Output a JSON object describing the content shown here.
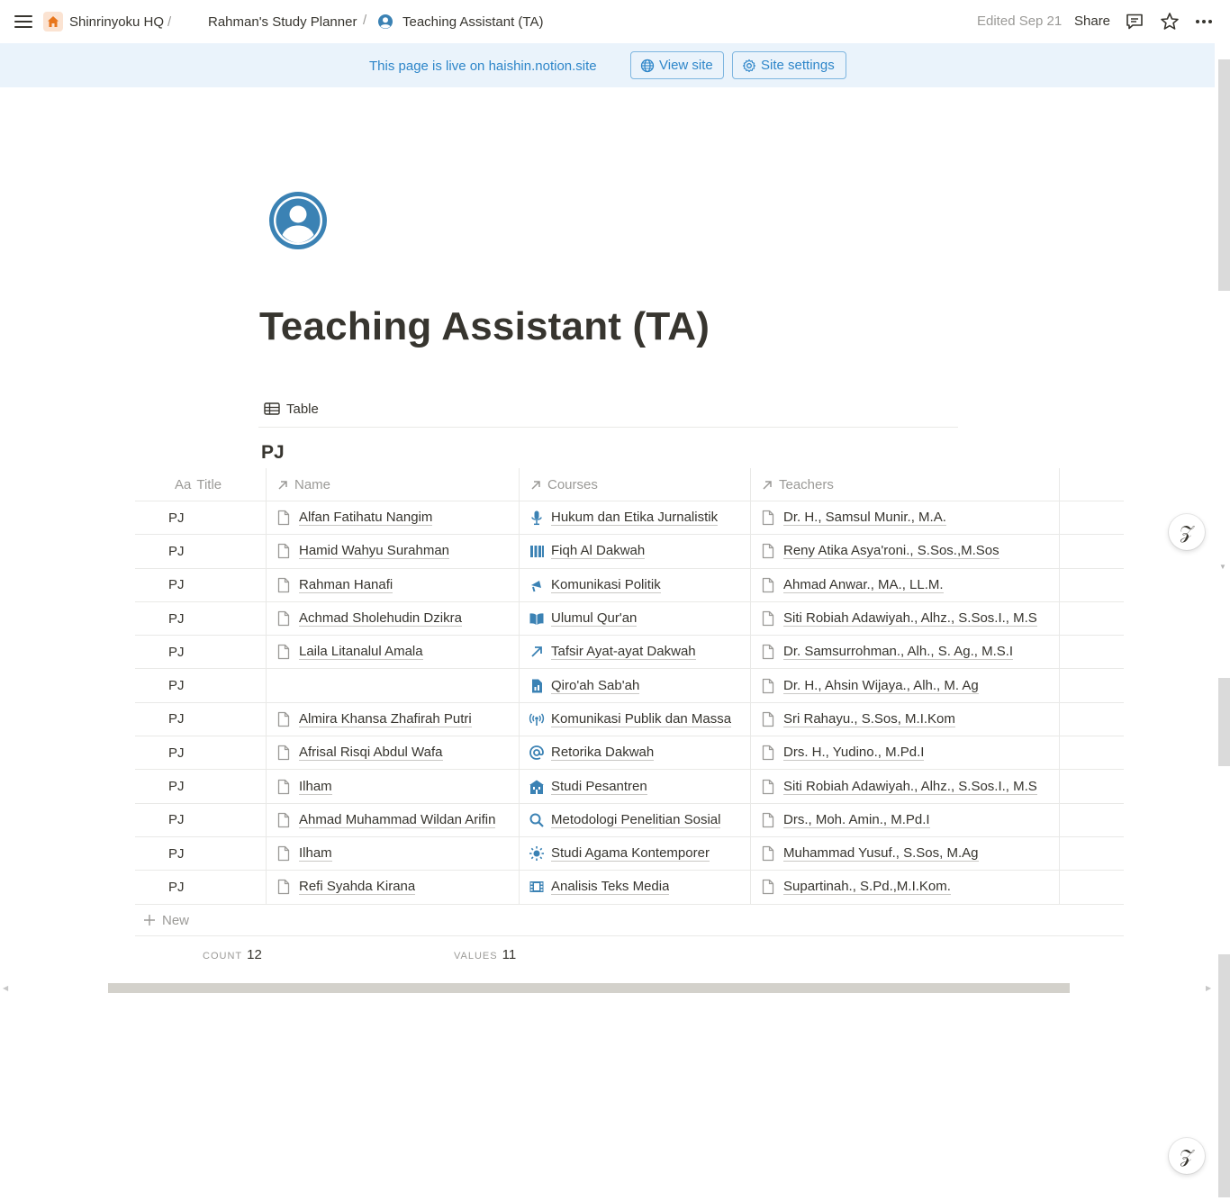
{
  "breadcrumb": {
    "workspace": "Shinrinyoku HQ",
    "separator": "/",
    "planner": "Rahman's Study Planner",
    "current": "Teaching Assistant (TA)"
  },
  "topbar": {
    "edited": "Edited Sep 21",
    "share": "Share",
    "icons": [
      "menu-icon",
      "comment-icon",
      "star-icon",
      "more-icon"
    ]
  },
  "banner": {
    "text": "This page is live on haishin.notion.site",
    "view_site": "View site",
    "site_settings": "Site settings"
  },
  "page": {
    "title": "Teaching Assistant (TA)",
    "icon": "user-circle-icon"
  },
  "view": {
    "tab_label": "Table",
    "group_title": "PJ"
  },
  "table": {
    "columns": [
      {
        "label": "Title",
        "prefix": "Aa"
      },
      {
        "label": "Name",
        "icon": "relation-arrow-icon"
      },
      {
        "label": "Courses",
        "icon": "relation-arrow-icon"
      },
      {
        "label": "Teachers",
        "icon": "relation-arrow-icon"
      }
    ],
    "rows": [
      {
        "title": "PJ",
        "name": "Alfan Fatihatu Nangim",
        "course": "Hukum dan Etika Jurnalistik",
        "course_icon": "microphone-icon",
        "teacher": "Dr. H., Samsul Munir., M.A."
      },
      {
        "title": "PJ",
        "name": "Hamid Wahyu Surahman",
        "course": "Fiqh Al Dakwah",
        "course_icon": "books-icon",
        "teacher": "Reny Atika Asya'roni., S.Sos.,M.Sos"
      },
      {
        "title": "PJ",
        "name": "Rahman Hanafi",
        "course": "Komunikasi Politik",
        "course_icon": "megaphone-icon",
        "teacher": "Ahmad Anwar., MA., LL.M."
      },
      {
        "title": "PJ",
        "name": "Achmad Sholehudin Dzikra",
        "course": "Ulumul Qur'an",
        "course_icon": "book-open-icon",
        "teacher": "Siti Robiah Adawiyah., Alhz., S.Sos.I., M.S"
      },
      {
        "title": "PJ",
        "name": "Laila Litanalul Amala",
        "course": "Tafsir Ayat-ayat Dakwah",
        "course_icon": "arrow-up-right-icon",
        "teacher": "Dr. Samsurrohman., Alh., S. Ag., M.S.I"
      },
      {
        "title": "PJ",
        "name": "",
        "course": "Qiro'ah Sab'ah",
        "course_icon": "chart-doc-icon",
        "teacher": "Dr. H., Ahsin Wijaya., Alh., M. Ag"
      },
      {
        "title": "PJ",
        "name": "Almira Khansa Zhafirah Putri",
        "course": "Komunikasi Publik dan Massa",
        "course_icon": "broadcast-icon",
        "teacher": "Sri Rahayu., S.Sos, M.I.Kom"
      },
      {
        "title": "PJ",
        "name": "Afrisal Risqi Abdul Wafa",
        "course": "Retorika Dakwah",
        "course_icon": "at-sign-icon",
        "teacher": "Drs. H., Yudino., M.Pd.I"
      },
      {
        "title": "PJ",
        "name": "Ilham",
        "course": "Studi Pesantren",
        "course_icon": "building-icon",
        "teacher": "Siti Robiah Adawiyah., Alhz., S.Sos.I., M.S"
      },
      {
        "title": "PJ",
        "name": "Ahmad Muhammad Wildan Arifin",
        "course": "Metodologi Penelitian Sosial",
        "course_icon": "search-icon",
        "teacher": "Drs., Moh. Amin., M.Pd.I"
      },
      {
        "title": "PJ",
        "name": "Ilham",
        "course": "Studi Agama Kontemporer",
        "course_icon": "sun-icon",
        "teacher": "Muhammad Yusuf., S.Sos, M.Ag"
      },
      {
        "title": "PJ",
        "name": "Refi Syahda Kirana",
        "course": "Analisis Teks Media",
        "course_icon": "film-icon",
        "teacher": "Supartinah., S.Pd.,M.I.Kom."
      }
    ],
    "new_label": "New",
    "calc": {
      "count_label": "COUNT",
      "count": "12",
      "values_label": "VALUES",
      "values": "11"
    }
  },
  "colors": {
    "accent": "#2e86c9",
    "banner_bg": "#eaf3fb",
    "text": "#37352f",
    "muted": "#9b9a97",
    "border": "#e9e9e7",
    "icon_blue": "#3b82b4"
  },
  "helper_glyph": "𝒵"
}
